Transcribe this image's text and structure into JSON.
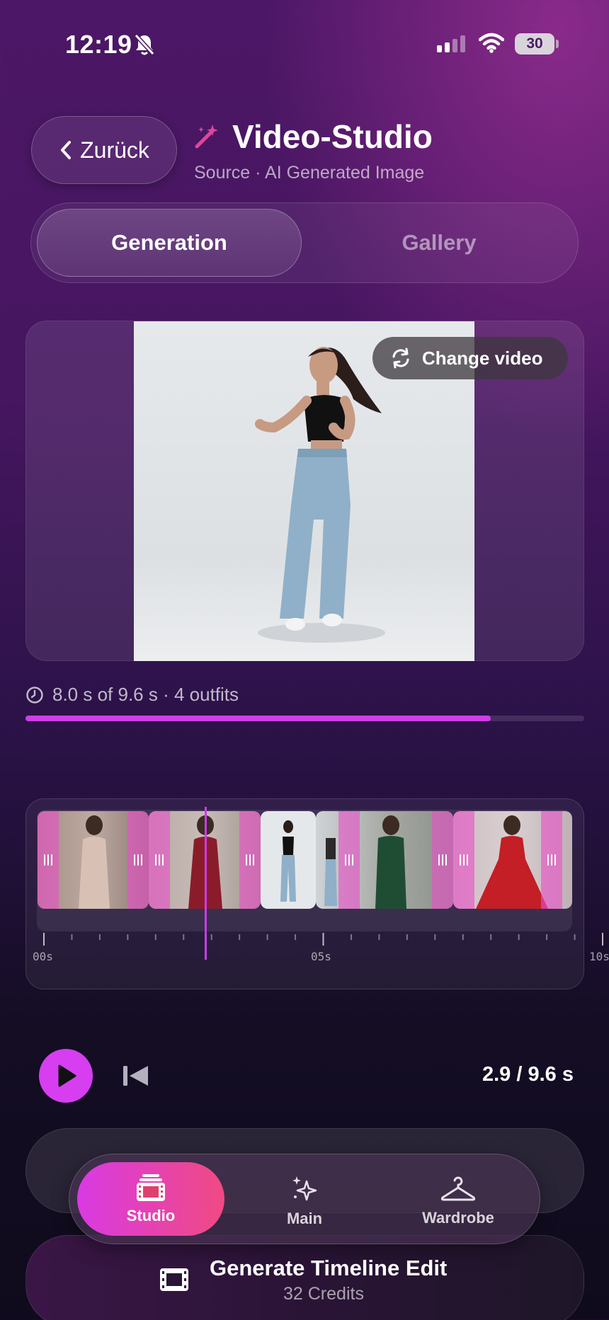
{
  "status_bar": {
    "time": "12:19",
    "battery": "30"
  },
  "header": {
    "back_label": "Zurück",
    "title": "Video-Studio",
    "subtitle": "Source · AI Generated Image"
  },
  "tabs": {
    "generation": "Generation",
    "gallery": "Gallery"
  },
  "preview": {
    "change_video_label": "Change video"
  },
  "progress": {
    "text": "8.0 s of 9.6 s · 4 outfits",
    "fraction": 0.833
  },
  "timeline": {
    "tick_labels": [
      "00s",
      "05s",
      "10s"
    ],
    "playhead_seconds": 2.9,
    "duration_seconds": 9.6
  },
  "playback": {
    "time_readout": "2.9 / 9.6 s"
  },
  "bottom_nav": {
    "items": [
      {
        "label": "Studio",
        "icon": "film-stack-icon"
      },
      {
        "label": "Main",
        "icon": "sparkles-icon"
      },
      {
        "label": "Wardrobe",
        "icon": "hanger-icon"
      }
    ]
  },
  "generate": {
    "title": "Generate Timeline Edit",
    "credits": "32 Credits"
  },
  "colors": {
    "accent": "#d63ef0",
    "accent_pink": "#f04a82",
    "handle": "#e850c8"
  }
}
